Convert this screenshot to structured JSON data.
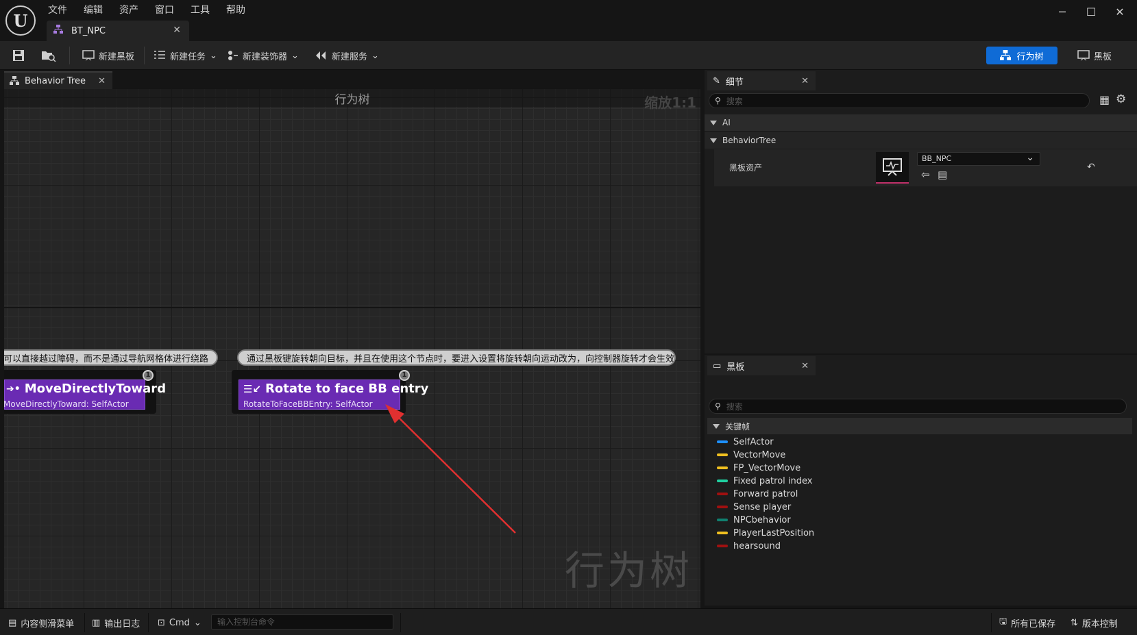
{
  "app": {
    "logo_text": "U",
    "menu": [
      "文件",
      "编辑",
      "资产",
      "窗口",
      "工具",
      "帮助"
    ],
    "doc_tab": "BT_NPC",
    "window_controls": [
      "minimize-icon",
      "maximize-icon",
      "close-icon"
    ]
  },
  "toolbar": {
    "new_blackboard": "新建黑板",
    "new_task": "新建任务",
    "new_decorator": "新建装饰器",
    "new_service": "新建服务",
    "mode_behavior_tree": "行为树",
    "mode_blackboard": "黑板"
  },
  "graph": {
    "tab_label": "Behavior Tree",
    "title": "行为树",
    "zoom": "缩放1:1",
    "watermark": "行为树",
    "comments": [
      "可以直接越过障碍，而不是通过导航网格体进行绕路",
      "通过黑板键旋转朝向目标，并且在使用这个节点时，要进入设置将旋转朝向运动改为，向控制器旋转才会生效"
    ],
    "nodes": [
      {
        "title": "MoveDirectlyToward",
        "subtitle": "MoveDirectlyToward: SelfActor",
        "pin": "1"
      },
      {
        "title": "Rotate to face BB entry",
        "subtitle": "RotateToFaceBBEntry: SelfActor",
        "pin": "1"
      }
    ],
    "accent_color": "#6a2bb3",
    "arrow_color": "#e03030"
  },
  "details": {
    "tab_label": "细节",
    "search_placeholder": "搜索",
    "categories": [
      "AI",
      "BehaviorTree"
    ],
    "property_label": "黑板资产",
    "property_value": "BB_NPC"
  },
  "blackboard": {
    "tab_label": "黑板",
    "search_placeholder": "搜索",
    "section": "关键帧",
    "keys": [
      {
        "name": "SelfActor",
        "color": "#1e90ff"
      },
      {
        "name": "VectorMove",
        "color": "#f0c020"
      },
      {
        "name": "FP_VectorMove",
        "color": "#f0c020"
      },
      {
        "name": "Fixed patrol index",
        "color": "#20d0a0"
      },
      {
        "name": "Forward patrol",
        "color": "#a01010"
      },
      {
        "name": "Sense player",
        "color": "#a01010"
      },
      {
        "name": "NPCbehavior",
        "color": "#108070"
      },
      {
        "name": "PlayerLastPosition",
        "color": "#f0c020"
      },
      {
        "name": "hearsound",
        "color": "#a01010"
      }
    ]
  },
  "statusbar": {
    "content_drawer": "内容侧滑菜单",
    "output_log": "输出日志",
    "cmd": "Cmd",
    "console_placeholder": "输入控制台命令",
    "all_saved": "所有已保存",
    "source_control": "版本控制"
  }
}
